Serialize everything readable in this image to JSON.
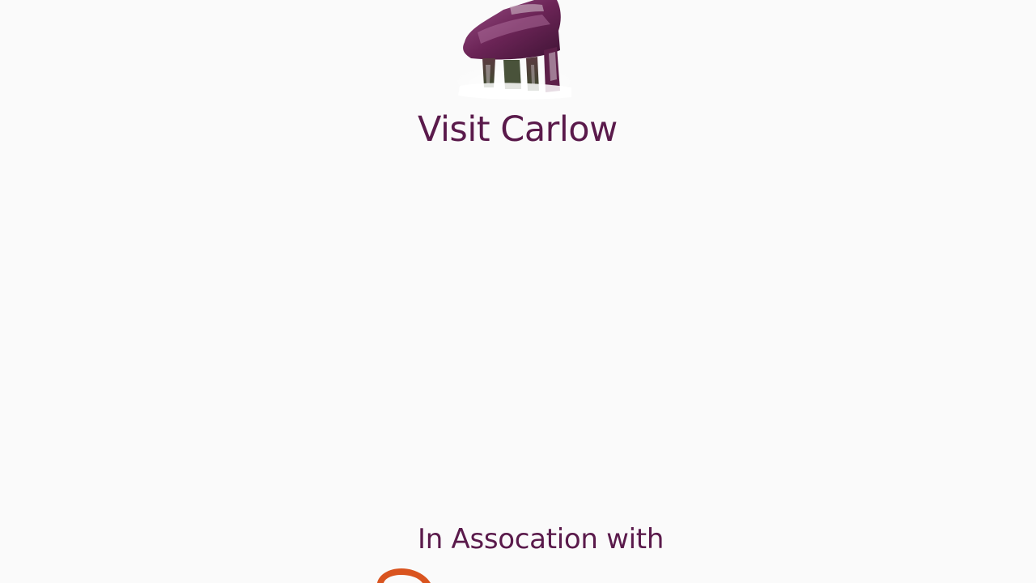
{
  "app": {
    "title": "Visit Carlow",
    "association_text": "In Assocation with"
  },
  "icons": {
    "logo": "dolmen-logo-icon",
    "partner": "partner-logo-icon"
  },
  "colors": {
    "background": "#fafafa",
    "brand_text": "#5a1a4b",
    "partner_accent": "#d9541f"
  }
}
